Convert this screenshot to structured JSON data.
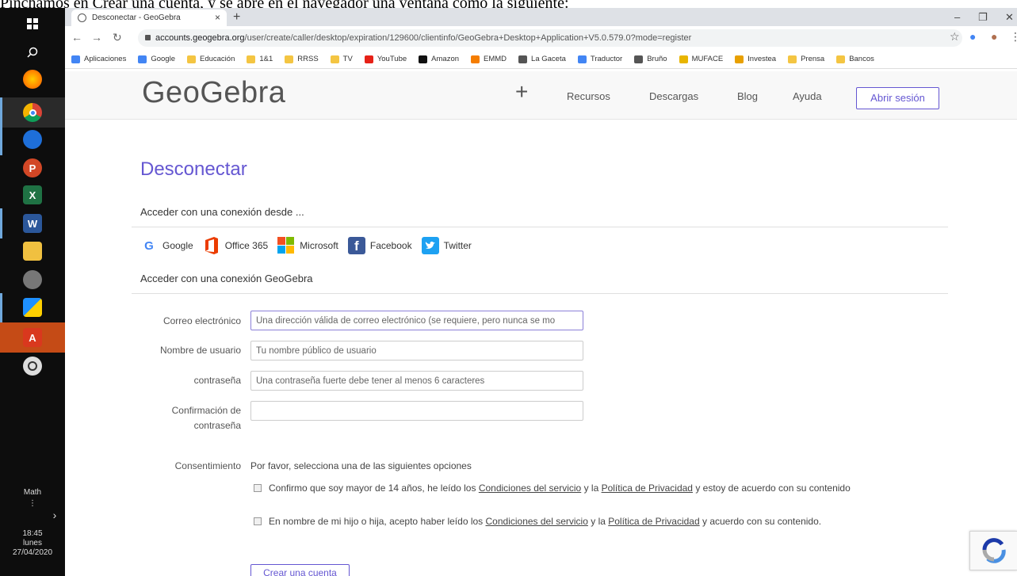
{
  "caption": "Pinchamos en Crear una cuenta, y se abre en el navegador una ventana como la siguiente:",
  "taskbar": {
    "math_label": "Math",
    "time": "18:45",
    "day": "lunes",
    "date": "27/04/2020"
  },
  "browser": {
    "tab_title": "Desconectar - GeoGebra",
    "url_host": "accounts.geogebra.org",
    "url_path": "/user/create/caller/desktop/expiration/129600/clientinfo/GeoGebra+Desktop+Application+V5.0.579.0?mode=register",
    "bookmarks": [
      {
        "label": "Aplicaciones",
        "icon": "apps-grid-icon",
        "color": "#4285f4"
      },
      {
        "label": "Google",
        "icon": "google-icon",
        "color": "#4285f4"
      },
      {
        "label": "Educación",
        "icon": "folder-icon",
        "color": "#f4c542"
      },
      {
        "label": "1&1",
        "icon": "folder-icon",
        "color": "#f4c542"
      },
      {
        "label": "RRSS",
        "icon": "folder-icon",
        "color": "#f4c542"
      },
      {
        "label": "TV",
        "icon": "folder-icon",
        "color": "#f4c542"
      },
      {
        "label": "YouTube",
        "icon": "youtube-icon",
        "color": "#e62117"
      },
      {
        "label": "Amazon",
        "icon": "amazon-icon",
        "color": "#111111"
      },
      {
        "label": "EMMD",
        "icon": "blogger-icon",
        "color": "#f57d00"
      },
      {
        "label": "La Gaceta",
        "icon": "globe-icon",
        "color": "#555555"
      },
      {
        "label": "Traductor",
        "icon": "translate-icon",
        "color": "#4285f4"
      },
      {
        "label": "Bruño",
        "icon": "globe-icon",
        "color": "#555555"
      },
      {
        "label": "MUFACE",
        "icon": "muface-icon",
        "color": "#e8b500"
      },
      {
        "label": "Investea",
        "icon": "investea-icon",
        "color": "#e8a000"
      },
      {
        "label": "Prensa",
        "icon": "folder-icon",
        "color": "#f4c542"
      },
      {
        "label": "Bancos",
        "icon": "folder-icon",
        "color": "#f4c542"
      }
    ]
  },
  "header": {
    "logo": "GeoGebra",
    "plus": "+",
    "nav": [
      "Recursos",
      "Descargas",
      "Blog",
      "Ayuda"
    ],
    "login": "Abrir sesión"
  },
  "main": {
    "title": "Desconectar",
    "connect_from": "Acceder con una conexión desde ...",
    "providers": [
      "Google",
      "Office 365",
      "Microsoft",
      "Facebook",
      "Twitter"
    ],
    "connect_geogebra": "Acceder con una conexión GeoGebra",
    "fields": {
      "email_label": "Correo electrónico",
      "email_placeholder": "Una dirección válida de correo electrónico (se requiere, pero nunca se mo",
      "username_label": "Nombre de usuario",
      "username_placeholder": "Tu nombre público de usuario",
      "password_label": "contraseña",
      "password_placeholder": "Una contraseña fuerte debe tener al menos 6 caracteres",
      "confirm_label_1": "Confirmación de",
      "confirm_label_2": "contraseña"
    },
    "consent": {
      "label": "Consentimiento",
      "intro": "Por favor, selecciona una de las siguientes opciones",
      "opt1_a": "Confirmo que soy mayor de 14 años, he leído los ",
      "opt1_link1": "Condiciones del servicio",
      "opt1_b": " y la ",
      "opt1_link2": "Política de Privacidad",
      "opt1_c": " y estoy de acuerdo con su contenido",
      "opt2_a": "En nombre de mi hijo o hija, acepto haber leído los ",
      "opt2_link1": "Condiciones del servicio",
      "opt2_b": " y la ",
      "opt2_link2": "Política de Privacidad",
      "opt2_c": " y acuerdo con su contenido."
    },
    "create_button": "Crear una cuenta"
  },
  "colors": {
    "accent": "#6557d2"
  }
}
